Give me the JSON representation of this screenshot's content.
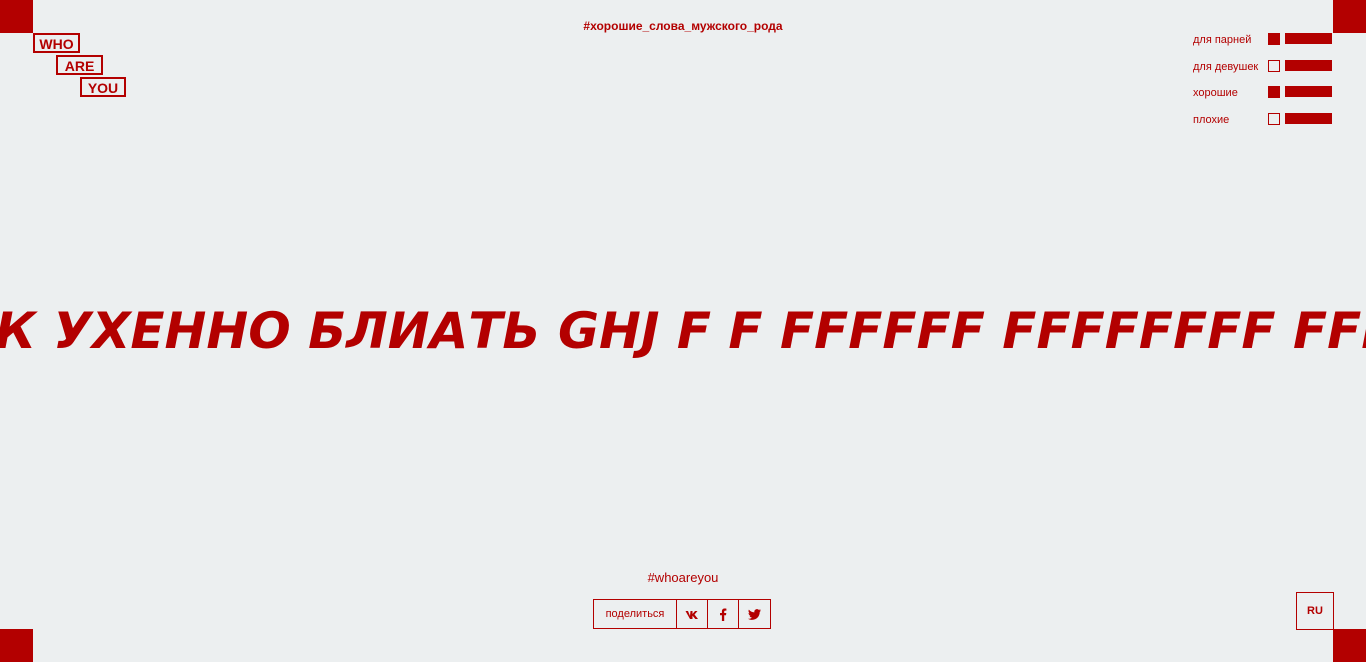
{
  "logo": {
    "word1": "WHO",
    "word2": "ARE",
    "word3": "YOU"
  },
  "top_hashtag": "#хорошие_слова_мужского_рода",
  "filters": [
    {
      "label": "для парней",
      "checked": true
    },
    {
      "label": "для девушек",
      "checked": false
    },
    {
      "label": "хорошие",
      "checked": true
    },
    {
      "label": "плохие",
      "checked": false
    }
  ],
  "marquee": {
    "text": "К УХЕННО БЛИАТЬ GHJ F F FFFFFF FFFFFFFF FFFF"
  },
  "bottom": {
    "hashtag": "#whoareyou",
    "share_label": "поделиться",
    "share_buttons": [
      {
        "icon": "vk-icon"
      },
      {
        "icon": "facebook-icon"
      },
      {
        "icon": "twitter-icon"
      }
    ],
    "language": "RU"
  },
  "colors": {
    "accent": "#b30000",
    "background": "#eceff0"
  }
}
